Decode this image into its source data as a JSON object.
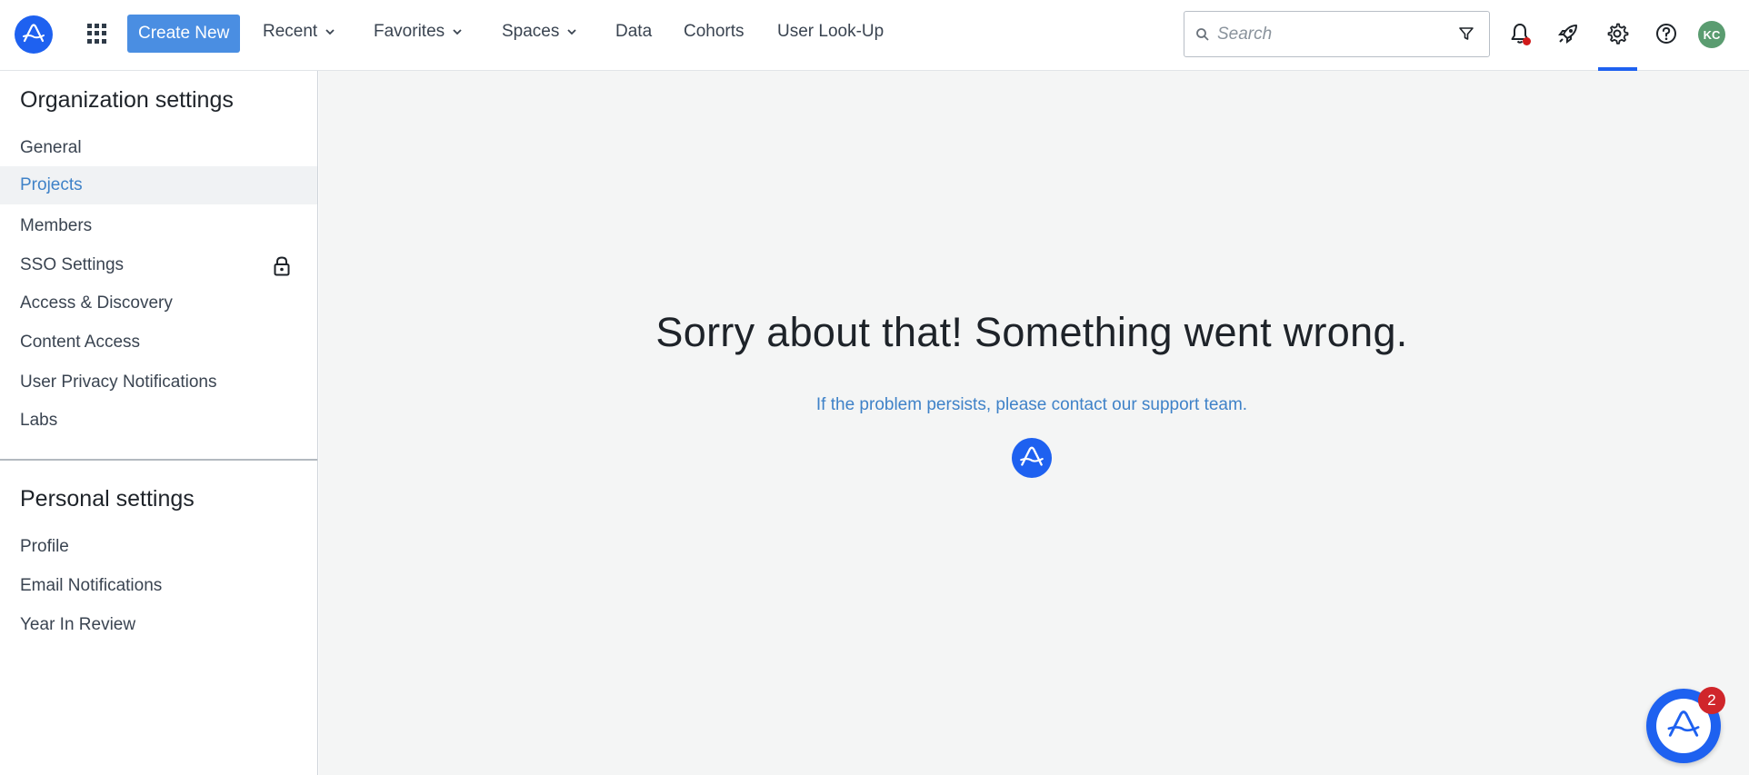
{
  "topbar": {
    "create_label": "Create New",
    "nav": [
      {
        "label": "Recent"
      },
      {
        "label": "Favorites"
      },
      {
        "label": "Spaces"
      },
      {
        "label": "Data"
      },
      {
        "label": "Cohorts"
      },
      {
        "label": "User Look-Up"
      }
    ],
    "search_placeholder": "Search",
    "avatar_initials": "KC",
    "icons": [
      "amplitude-logo-icon",
      "app-grid-icon",
      "bell-icon",
      "rocket-icon",
      "gear-icon",
      "help-icon"
    ]
  },
  "sidebar": {
    "org_title": "Organization settings",
    "org_items": [
      {
        "label": "General"
      },
      {
        "label": "Projects"
      },
      {
        "label": "Members"
      },
      {
        "label": "SSO Settings"
      },
      {
        "label": "Access & Discovery"
      },
      {
        "label": "Content Access"
      },
      {
        "label": "User Privacy Notifications"
      },
      {
        "label": "Labs"
      }
    ],
    "active_item": "Projects",
    "personal_title": "Personal settings",
    "personal_items": [
      {
        "label": "Profile"
      },
      {
        "label": "Email Notifications"
      },
      {
        "label": "Year In Review"
      }
    ]
  },
  "main": {
    "error_title": "Sorry about that! Something went wrong.",
    "error_subtitle": "If the problem persists, please contact our support team."
  },
  "chat": {
    "badge_count": "2"
  },
  "colors": {
    "brand": "#1e61f0",
    "create_button": "#4a8ee2",
    "link": "#3f82c8",
    "notification_dot": "#d11a1a",
    "avatar_bg": "#5a9c70"
  }
}
